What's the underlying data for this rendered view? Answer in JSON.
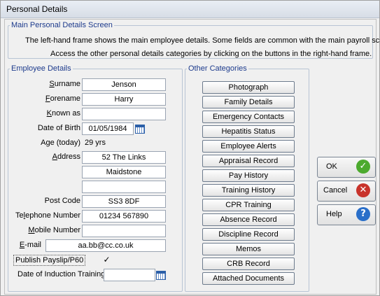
{
  "window": {
    "title": "Personal Details"
  },
  "intro": {
    "legend": "Main Personal Details Screen",
    "line1": "The left-hand frame shows the main employee details.  Some fields are common with the main payroll screen.",
    "line2": "Access the other personal details categories by clicking on the buttons in the right-hand frame."
  },
  "employee": {
    "legend": "Employee Details",
    "surname_label_u": "S",
    "surname_label_rest": "urname",
    "surname": "Jenson",
    "forename_label_u": "F",
    "forename_label_rest": "orename",
    "forename": "Harry",
    "known_label_u": "K",
    "known_label_rest": "nown as",
    "known_as": "",
    "dob_label": "Date of Birth",
    "dob": "01/05/1984",
    "age_label": "Age (today)",
    "age": "29 yrs",
    "address_label_u": "A",
    "address_label_rest": "ddress",
    "address1": "52 The Links",
    "address2": "Maidstone",
    "address3": "",
    "postcode_label": "Post Code",
    "postcode": "SS3 8DF",
    "tel_label_pre": "Te",
    "tel_label_u": "l",
    "tel_label_rest": "ephone Number",
    "telephone": "01234 567890",
    "mobile_label_u": "M",
    "mobile_label_rest": "obile Number",
    "mobile": "",
    "email_label_u": "E",
    "email_label_rest": "-mail",
    "email": "aa.bb@cc.co.uk",
    "publish_label": "Publish Payslip/P60",
    "publish_checked": "✓",
    "induction_label": "Date of Induction Training",
    "induction": ""
  },
  "categories": {
    "legend": "Other Categories",
    "items": [
      "Photograph",
      "Family Details",
      "Emergency Contacts",
      "Hepatitis Status",
      "Employee Alerts",
      "Appraisal Record",
      "Pay History",
      "Training History",
      "CPR Training",
      "Absence Record",
      "Discipline Record",
      "Memos",
      "CRB Record",
      "Attached Documents"
    ]
  },
  "buttons": {
    "ok": "OK",
    "cancel": "Cancel",
    "help": "Help",
    "ok_icon": "check-icon",
    "cancel_icon": "x-icon",
    "help_icon": "question-icon",
    "ok_color": "#4caa2e",
    "cancel_color": "#c8332b",
    "help_color": "#2a6fc9"
  }
}
